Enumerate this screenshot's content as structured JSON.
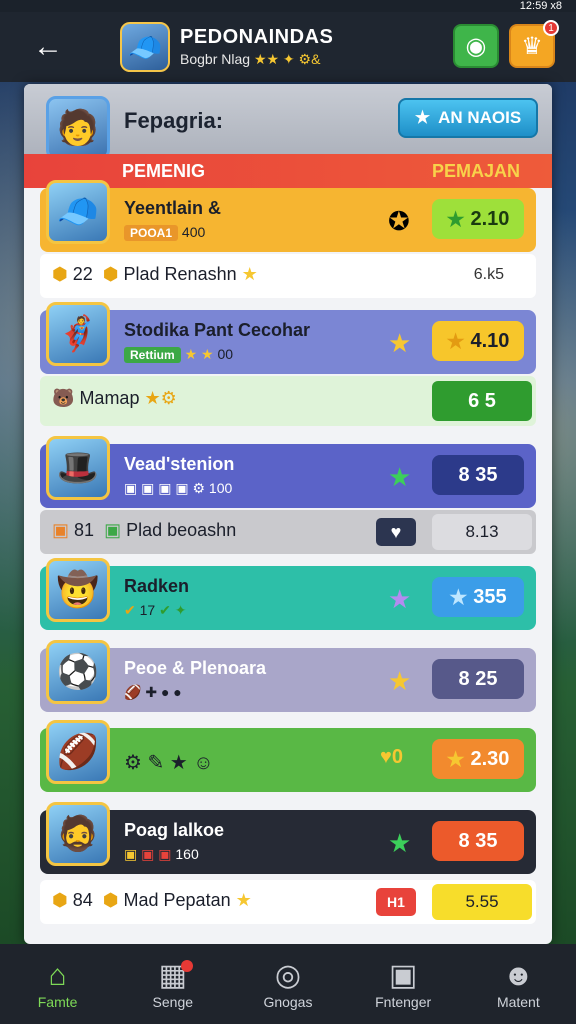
{
  "status": {
    "time": "12:59 x8"
  },
  "header": {
    "title": "PEDONAINDAS",
    "subtitle": "Bogbr Nlag",
    "subtitle_stars": "★★ ✦ ⚙&",
    "avatar_icon": "player-avatar"
  },
  "panel": {
    "title": "Fepagria:",
    "action_button": "AN NAOIS",
    "col_left": "PEMENIG",
    "col_right": "PEMAJAN"
  },
  "rows": [
    {
      "name": "Yeentlain &",
      "tag": "POOA1",
      "tag_extra": "400",
      "score": "2.10",
      "bg": "#f6b531",
      "score_bg": "#9ee03a",
      "score_color": "#1b3a10",
      "avatar": "🧢"
    },
    {
      "name": "Stodika Pant Cecohar",
      "tag": "Rettium",
      "tag_extra": "00",
      "score": "4.10",
      "bg": "#7b86d4",
      "score_bg": "#f7c62b",
      "score_color": "#1b1f2b",
      "avatar": "🦸"
    },
    {
      "name": "Vead'stenion",
      "tag": "",
      "tag_extra": "100",
      "score": "8 35",
      "bg": "#5b63c8",
      "score_bg": "#2c3a8a",
      "score_color": "#ffffff",
      "avatar": "🎩"
    },
    {
      "name": "Radken",
      "tag": "",
      "tag_extra": "17",
      "score": "355",
      "bg": "#2dbfa8",
      "score_bg": "#3b9de8",
      "score_color": "#ffffff",
      "avatar": "🤠"
    },
    {
      "name": "Peoe & Plenoara",
      "tag": "",
      "tag_extra": "",
      "score": "8 25",
      "bg": "#a9a6c9",
      "score_bg": "#57598a",
      "score_color": "#ffffff",
      "avatar": "⚽"
    },
    {
      "name": "",
      "tag": "",
      "tag_extra": "",
      "score": "2.30",
      "bg": "#59b845",
      "score_bg": "#f28a2e",
      "score_color": "#ffffff",
      "avatar": "🏈"
    },
    {
      "name": "Poag lalkoe",
      "tag": "",
      "tag_extra": "160",
      "score": "8 35",
      "bg": "#262a35",
      "score_bg": "#ec5a2b",
      "score_color": "#ffffff",
      "avatar": "🧔"
    }
  ],
  "subs": [
    {
      "left_num": "22",
      "label": "Plad Renashn",
      "right": "6.k5",
      "bg": "#ffffff"
    },
    {
      "left_num": "",
      "label": "Mamap",
      "right": "6 5",
      "bg": "#dff3d9"
    },
    {
      "left_num": "81",
      "label": "Plad beoashn",
      "right": "8.13",
      "bg": "#c9c9cd"
    },
    {
      "left_num": "84",
      "label": "Mad Pepatan",
      "right": "5.55",
      "bg": "#ffffff"
    }
  ],
  "bottom_nav": [
    {
      "label": "Famte",
      "icon": "home-icon"
    },
    {
      "label": "Senge",
      "icon": "cards-icon"
    },
    {
      "label": "Gnogas",
      "icon": "search-icon"
    },
    {
      "label": "Fntenger",
      "icon": "camera-icon"
    },
    {
      "label": "Matent",
      "icon": "user-icon"
    }
  ]
}
